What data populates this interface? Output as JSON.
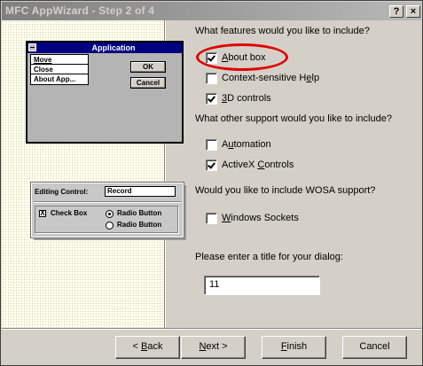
{
  "window": {
    "title": "MFC AppWizard - Step 2 of 4",
    "help_glyph": "?",
    "close_glyph": "×"
  },
  "preview": {
    "dialog_title": "Application",
    "menu_items": [
      "Move",
      "Close",
      "About App..."
    ],
    "ok_label": "OK",
    "cancel_label": "Cancel",
    "editing_control_label": "Editing Control:",
    "editing_control_value": "Record",
    "check_box_label": "Check Box",
    "check_box_glyph": "X",
    "radio1_label": "Radio Button",
    "radio2_label": "Radio Button"
  },
  "questions": {
    "features": "What features would you like to include?",
    "other_support": "What other support would you like to include?",
    "wosa": "Would you like to include WOSA support?",
    "title_prompt": "Please enter a title for your dialog:"
  },
  "features": [
    {
      "pre": "",
      "key": "A",
      "post": "bout box",
      "checked": true
    },
    {
      "pre": "Context-sensitive H",
      "key": "e",
      "post": "lp",
      "checked": false
    },
    {
      "pre": "",
      "key": "3",
      "post": "D controls",
      "checked": true
    }
  ],
  "other_support": [
    {
      "pre": "A",
      "key": "u",
      "post": "tomation",
      "checked": false
    },
    {
      "pre": "ActiveX ",
      "key": "C",
      "post": "ontrols",
      "checked": true
    }
  ],
  "wosa": [
    {
      "pre": "",
      "key": "W",
      "post": "indows Sockets",
      "checked": false
    }
  ],
  "dialog_title_value": "11",
  "buttons": {
    "back": {
      "pre": "< ",
      "key": "B",
      "post": "ack"
    },
    "next": {
      "pre": "",
      "key": "N",
      "post": "ext >"
    },
    "finish": {
      "pre": "",
      "key": "F",
      "post": "inish"
    },
    "cancel": "Cancel"
  },
  "colors": {
    "highlight": "#e00000",
    "preview_titlebar": "#000080"
  }
}
